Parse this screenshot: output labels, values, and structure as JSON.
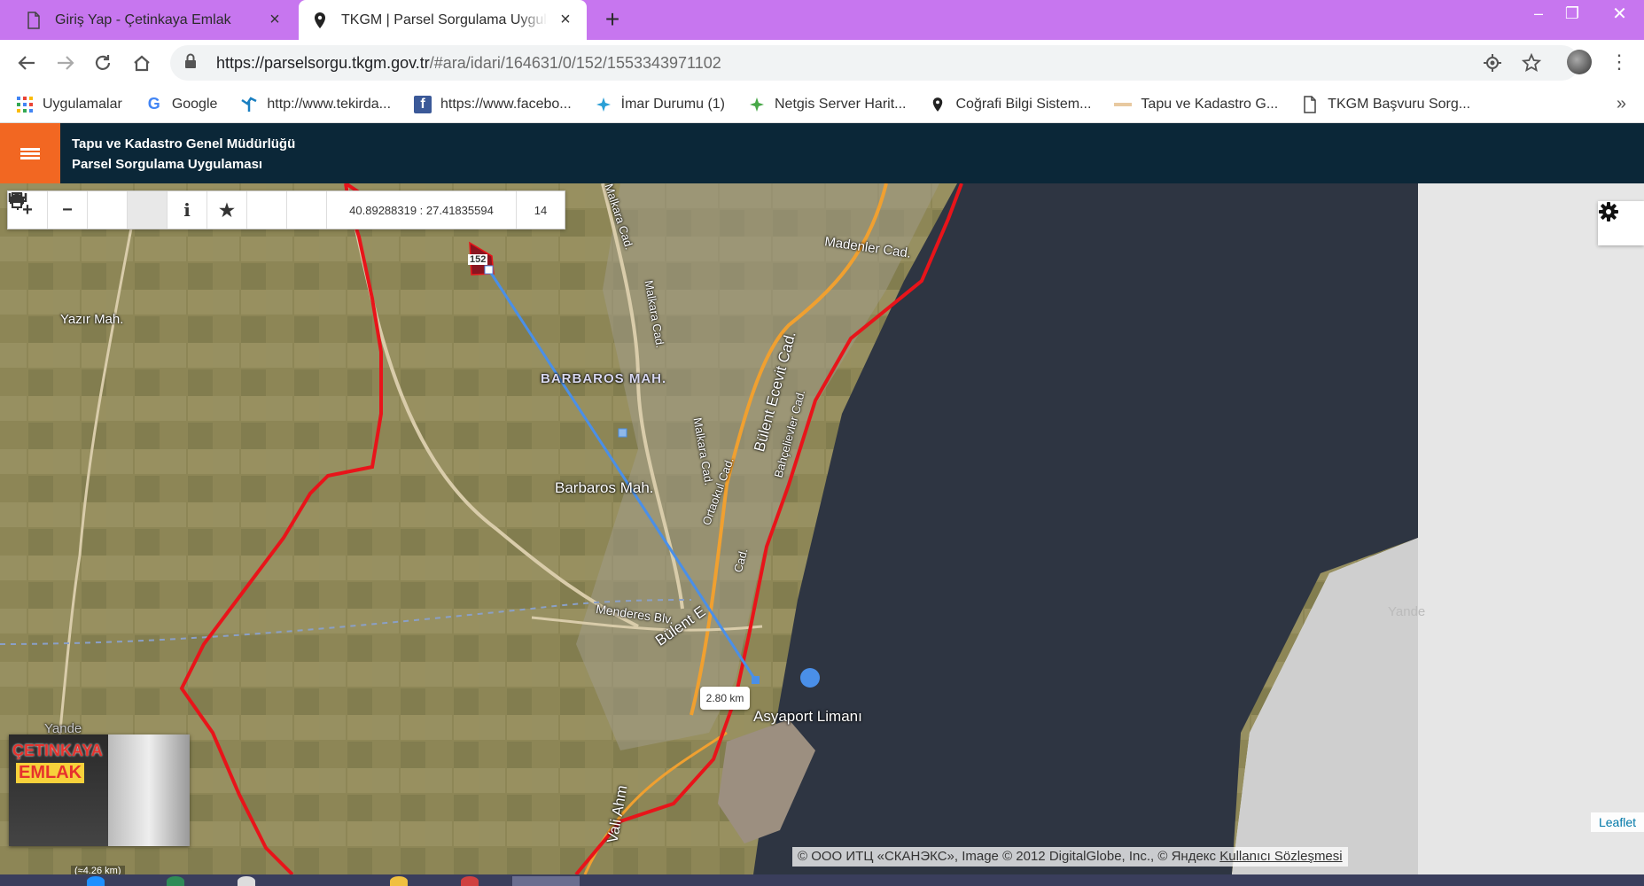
{
  "browser": {
    "tabs": [
      {
        "title": "Giriş Yap - Çetinkaya Emlak",
        "icon": "document-icon",
        "active": false
      },
      {
        "title": "TKGM | Parsel Sorgulama Uygulaması",
        "icon": "location-pin-icon",
        "active": true
      }
    ],
    "new_tab": "+",
    "window_controls": {
      "minimize": "–",
      "maximize": "❐",
      "close": "✕"
    },
    "address": {
      "host": "https://parselsorgu.tkgm.gov.tr",
      "path": "/#ara/idari/164631/0/152/1553343971102"
    },
    "bookmarks": [
      {
        "label": "Uygulamalar",
        "icon": "apps-grid-icon"
      },
      {
        "label": "Google",
        "icon": "google-icon"
      },
      {
        "label": "http://www.tekirda...",
        "icon": "tekirdag-icon"
      },
      {
        "label": "https://www.facebo...",
        "icon": "facebook-icon"
      },
      {
        "label": "İmar Durumu (1)",
        "icon": "imar-icon"
      },
      {
        "label": "Netgis Server Harit...",
        "icon": "netgis-icon"
      },
      {
        "label": "Coğrafi Bilgi Sistem...",
        "icon": "location-pin-icon"
      },
      {
        "label": "Tapu ve Kadastro G...",
        "icon": "tkgm-icon"
      },
      {
        "label": "TKGM Başvuru Sorg...",
        "icon": "document-icon"
      }
    ],
    "bookmarks_more": "»"
  },
  "app": {
    "title_line1": "Tapu ve Kadastro Genel Müdürlüğü",
    "title_line2": "Parsel Sorgulama Uygulaması"
  },
  "map": {
    "tools": {
      "coordinates": "40.89288319 : 27.41835594",
      "zoom": "14"
    },
    "labels": {
      "yazir": "Yazır Mah.",
      "barbaros_upper": "BARBAROS MAH.",
      "barbaros": "Barbaros Mah.",
      "madenler": "Madenler Cad.",
      "malkara1": "Malkara Cad.",
      "malkara2": "Malkara Cad.",
      "malkara3": "Malkara Cad.",
      "bulent_ecevit": "Bülent Ecevit Cad.",
      "bahcelievler": "Bahçelievler Cad.",
      "ortaokul": "Ortaokul Cad.",
      "menderes": "Menderes Blv.",
      "bulent2": "Bülent E",
      "cad": "Cad.",
      "asyaport": "Asyaport Limanı",
      "vali": "Vali Ahm",
      "yandex_right": "Yande",
      "yandex_left": "Yande"
    },
    "parcel_number": "152",
    "distance": "2.80 km",
    "scale": "(≈4.26 km)",
    "attribution_text": "© ООО ИТЦ «СКАНЭКС», Image © 2012 DigitalGlobe, Inc., © Яндекс ",
    "attribution_link": "Kullanıcı Sözleşmesi",
    "leaflet": "Leaflet",
    "ad": {
      "line1": "ÇETINKAYA",
      "line2": "EMLAK"
    },
    "colors": {
      "boundary": "#e8141a",
      "measure": "#4a8fe8",
      "sea": "#2d3340",
      "land": "#8f8a5a"
    }
  }
}
